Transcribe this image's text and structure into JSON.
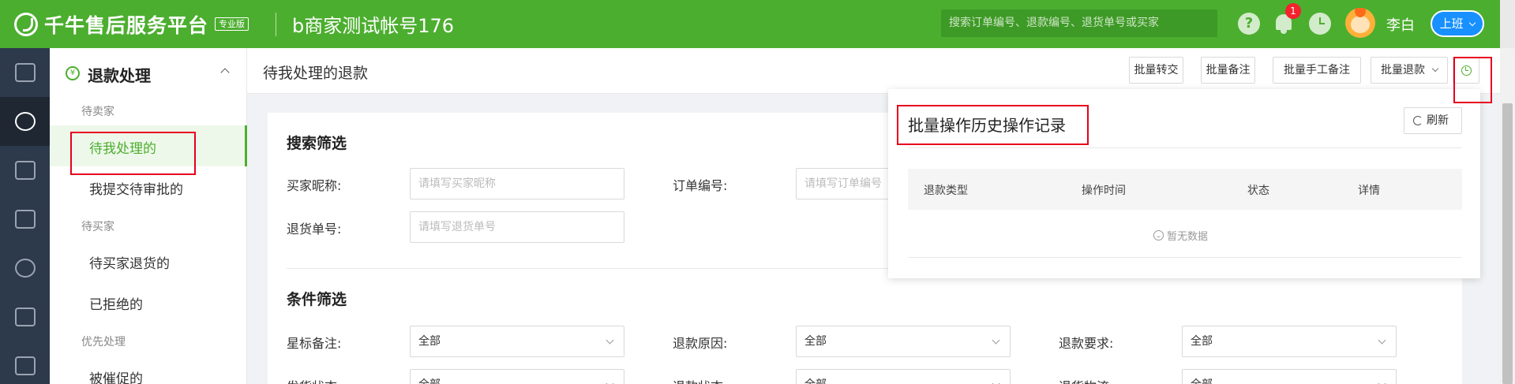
{
  "header": {
    "logo_text": "千牛售后服务平台",
    "logo_badge": "专业版",
    "account_title": "b商家测试帐号176",
    "search_placeholder": "搜索订单编号、退款编号、退货单号或买家",
    "notification_count": "1",
    "user_name": "李白",
    "duty_button": "上班",
    "colors": {
      "brand": "#4cae2f",
      "duty": "#1890ff",
      "badge": "#f5222d"
    }
  },
  "iconbar": {
    "items": [
      "home-icon",
      "refund-icon",
      "list-icon",
      "return-icon",
      "compass-icon",
      "users-icon",
      "calendar-icon"
    ],
    "active_index": 1
  },
  "sidebar": {
    "title": "退款处理",
    "groups": [
      {
        "label": "待卖家",
        "items": [
          "待我处理的",
          "我提交待审批的"
        ]
      },
      {
        "label": "待买家",
        "items": [
          "待买家退货的",
          "已拒绝的"
        ]
      },
      {
        "label": "优先处理",
        "items": [
          "被催促的"
        ]
      }
    ],
    "active_item": "待我处理的"
  },
  "main": {
    "title": "待我处理的退款",
    "toolbar": {
      "batch_transfer": "批量转交",
      "batch_note": "批量备注",
      "batch_manual_note": "批量手工备注",
      "batch_refund": "批量退款"
    },
    "search_section": {
      "title": "搜索筛选",
      "buyer_nick_label": "买家昵称:",
      "buyer_nick_placeholder": "请填写买家昵称",
      "order_no_label": "订单编号:",
      "order_no_placeholder": "请填写订单编号",
      "return_no_label": "退货单号:",
      "return_no_placeholder": "请填写退货单号"
    },
    "condition_section": {
      "title": "条件筛选",
      "star_note_label": "星标备注:",
      "star_note_value": "全部",
      "refund_reason_label": "退款原因:",
      "refund_reason_value": "全部",
      "refund_request_label": "退款要求:",
      "refund_request_value": "全部",
      "ship_status_label": "发货状态:",
      "ship_status_value": "全部",
      "refund_status_label": "退款状态:",
      "refund_status_value": "全部",
      "return_logistics_label": "退货物流:",
      "return_logistics_value": "全部"
    }
  },
  "history_panel": {
    "title": "批量操作历史操作记录",
    "refresh_label": "刷新",
    "columns": [
      "退款类型",
      "操作时间",
      "状态",
      "详情"
    ],
    "rows": [],
    "empty_text": "暂无数据"
  }
}
